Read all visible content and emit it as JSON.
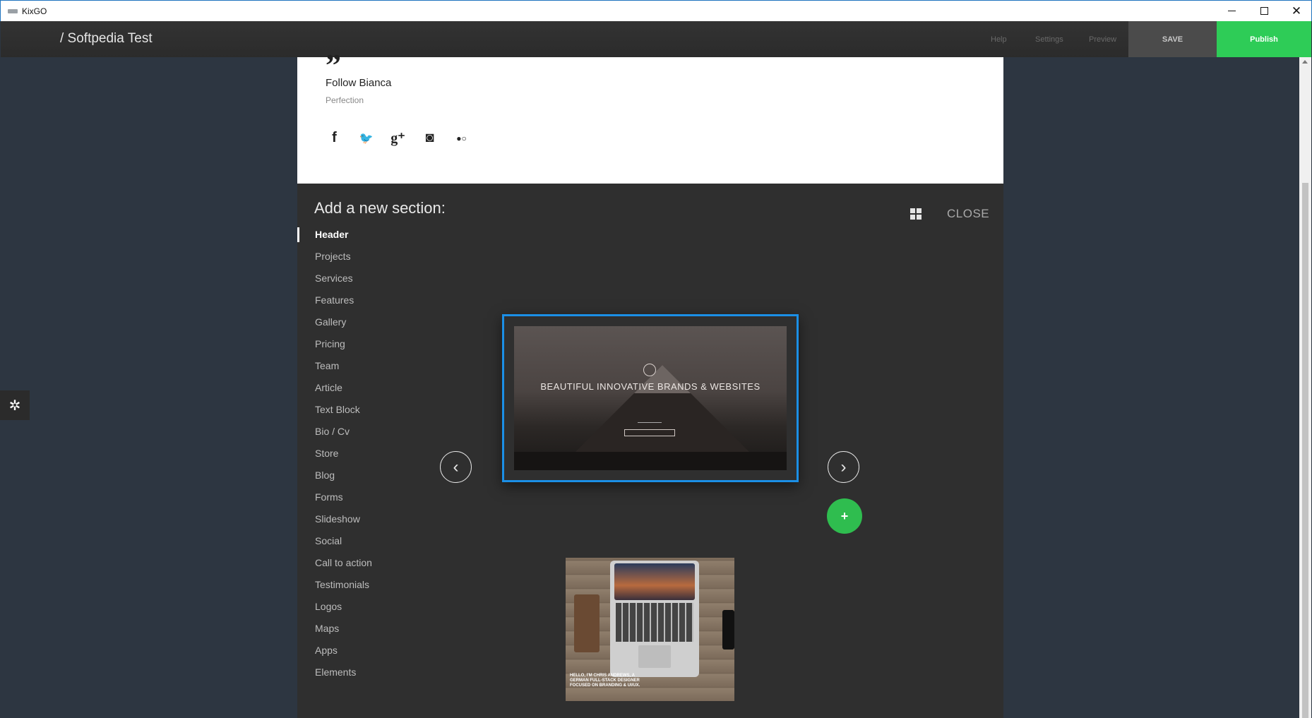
{
  "window": {
    "title": "KixGO",
    "minimize_label": "—",
    "close_label": "✕"
  },
  "toolbar": {
    "site_name": "/ Softpedia Test",
    "help_label": "Help",
    "settings_label": "Settings",
    "preview_label": "Preview",
    "save_label": "SAVE",
    "publish_label": "Publish"
  },
  "side": {
    "gear_glyph": "✲"
  },
  "content": {
    "quote_mark": "”",
    "follow_title": "Follow Bianca",
    "follow_subtitle": "Perfection",
    "social": [
      {
        "name": "facebook-icon",
        "glyph": "f"
      },
      {
        "name": "twitter-icon",
        "glyph": "🐦"
      },
      {
        "name": "google-plus-icon",
        "glyph": "g⁺"
      },
      {
        "name": "instagram-icon",
        "glyph": "◙"
      },
      {
        "name": "flickr-icon",
        "glyph": "●○"
      }
    ]
  },
  "panel": {
    "heading": "Add a new section:",
    "close_label": "CLOSE",
    "sections": [
      "Header",
      "Projects",
      "Services",
      "Features",
      "Gallery",
      "Pricing",
      "Team",
      "Article",
      "Text Block",
      "Bio / Cv",
      "Store",
      "Blog",
      "Forms",
      "Slideshow",
      "Social",
      "Call to action",
      "Testimonials",
      "Logos",
      "Maps",
      "Apps",
      "Elements"
    ],
    "active_section": "Header",
    "prev_glyph": "‹",
    "next_glyph": "›",
    "add_glyph": "+",
    "preview_text": "BEAUTIFUL INNOVATIVE BRANDS & WEBSITES",
    "preview_next_caption": "HELLO, I'M CHRIS ANDREWS, A GERMAN FULL-STACK DESIGNER FOCUSED ON BRANDING & UI/UX."
  },
  "colors": {
    "background": "#2d3641",
    "publish": "#2ecc57",
    "selection": "#1b8fe6",
    "add_button": "#2fbd4f"
  }
}
